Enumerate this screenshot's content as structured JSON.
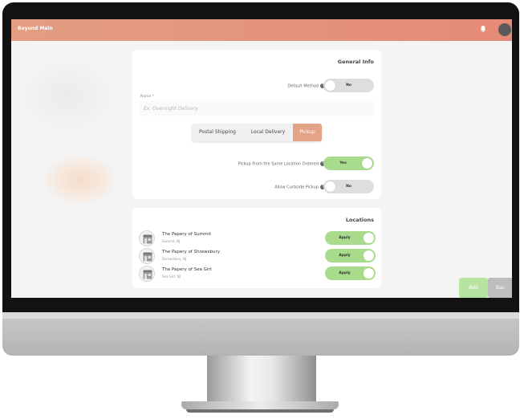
{
  "header": {
    "brand": "Beyond Main"
  },
  "general_info": {
    "title": "General Info",
    "default_method": {
      "label": "Default Method",
      "value": "No"
    },
    "name": {
      "label": "Name *",
      "placeholder": "Ex. Overnight Delivery"
    },
    "methods": [
      {
        "label": "Postal Shipping",
        "active": false
      },
      {
        "label": "Local Delivery",
        "active": false
      },
      {
        "label": "Pickup",
        "active": true
      }
    ],
    "pickup_same_location": {
      "label": "Pickup From the Same Location Ordered",
      "value": "Yes"
    },
    "curbside_pickup": {
      "label": "Allow Curbside Pickup",
      "value": "No"
    }
  },
  "locations": {
    "title": "Locations",
    "items": [
      {
        "name": "The Papery of Summit",
        "city": "Summit, NJ",
        "toggle": "Apply"
      },
      {
        "name": "The Papery of Shrewsbury",
        "city": "Shrewsbury, NJ",
        "toggle": "Apply"
      },
      {
        "name": "The Papery of Sea Girt",
        "city": "Sea Girt, NJ",
        "toggle": "Apply"
      }
    ]
  },
  "footer": {
    "add_label": "Add",
    "back_label": "Bac"
  },
  "icons": {
    "help": "question-circle-icon",
    "notifications": "bell-icon",
    "store": "storefront-icon"
  },
  "colors": {
    "header_gradient_start": "#e39e83",
    "header_gradient_end": "#e58a78",
    "toggle_on": "#a8dc8c",
    "segment_active": "#e3a387"
  }
}
